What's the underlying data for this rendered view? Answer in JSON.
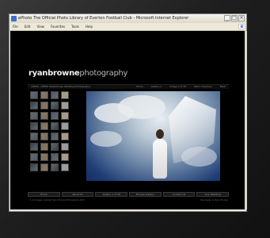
{
  "window": {
    "title": "ePhoto The Official Photo Library of Everton Football Club - Microsoft Internet Explorer",
    "buttons": [
      "_",
      "□",
      "×"
    ]
  },
  "menu": [
    "File",
    "Edit",
    "View",
    "Favorites",
    "Tools",
    "Help"
  ],
  "site": {
    "logo_first": "ryanbrowne",
    "logo_second": "photography",
    "strip_left": "LEEDS · LEEDS Waterhouse Wedding Photography",
    "strip_right": [
      "Home",
      "Gallery 1",
      "Image 1 of 30",
      "Next / Previous",
      "Back"
    ],
    "thumbnail_count": 32,
    "bottom_buttons": [
      "Home",
      "About Us",
      "Gallery 1 of 30",
      "Browse Gallery",
      "Contact Us",
      "Your Wedding"
    ],
    "footer_left": "© All images copyright Ryan Browne Photography 2007",
    "footer_right": "Site design by Ryan Browne"
  },
  "colors": {
    "background": "#000000",
    "sky": "#1e3d77",
    "chrome": "#ece9d8"
  }
}
